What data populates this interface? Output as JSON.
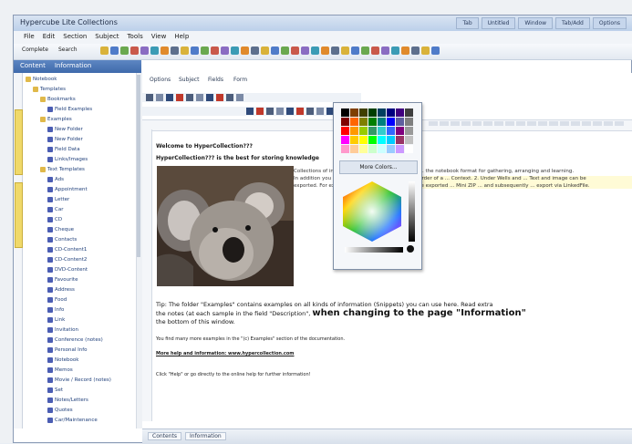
{
  "window": {
    "title": "Hypercube Lite Collections"
  },
  "title_tabs": [
    "Tab",
    "Untitled",
    "Window",
    "Tab/Add",
    "Options"
  ],
  "menu": [
    "File",
    "Edit",
    "Section",
    "Subject",
    "Tools",
    "View",
    "Help"
  ],
  "toolbar": {
    "label_a": "Complete",
    "label_b": "Search"
  },
  "left_pane": {
    "tabs": [
      "Content",
      "Information"
    ]
  },
  "tree": [
    {
      "label": "Notebook",
      "indent": 0,
      "folder": true
    },
    {
      "label": "Templates",
      "indent": 1,
      "folder": true
    },
    {
      "label": "Bookmarks",
      "indent": 2,
      "folder": true
    },
    {
      "label": "Field Examples",
      "indent": 3,
      "folder": false
    },
    {
      "label": "Examples",
      "indent": 2,
      "folder": true
    },
    {
      "label": "New Folder",
      "indent": 3,
      "folder": false
    },
    {
      "label": "New Folder",
      "indent": 3,
      "folder": false
    },
    {
      "label": "Field Data",
      "indent": 3,
      "folder": false
    },
    {
      "label": "Links/Images",
      "indent": 3,
      "folder": false
    },
    {
      "label": "Text Templates",
      "indent": 2,
      "folder": true
    },
    {
      "label": "Ads",
      "indent": 3,
      "folder": false
    },
    {
      "label": "Appointment",
      "indent": 3,
      "folder": false
    },
    {
      "label": "Letter",
      "indent": 3,
      "folder": false
    },
    {
      "label": "Car",
      "indent": 3,
      "folder": false
    },
    {
      "label": "CD",
      "indent": 3,
      "folder": false
    },
    {
      "label": "Cheque",
      "indent": 3,
      "folder": false
    },
    {
      "label": "Contacts",
      "indent": 3,
      "folder": false
    },
    {
      "label": "CD-Content1",
      "indent": 3,
      "folder": false
    },
    {
      "label": "CD-Content2",
      "indent": 3,
      "folder": false
    },
    {
      "label": "DVD-Content",
      "indent": 3,
      "folder": false
    },
    {
      "label": "Favourite",
      "indent": 3,
      "folder": false
    },
    {
      "label": "Address",
      "indent": 3,
      "folder": false
    },
    {
      "label": "Food",
      "indent": 3,
      "folder": false
    },
    {
      "label": "Info",
      "indent": 3,
      "folder": false
    },
    {
      "label": "Link",
      "indent": 3,
      "folder": false
    },
    {
      "label": "Invitation",
      "indent": 3,
      "folder": false
    },
    {
      "label": "Conference (notes)",
      "indent": 3,
      "folder": false
    },
    {
      "label": "Personal Info",
      "indent": 3,
      "folder": false
    },
    {
      "label": "Notebook",
      "indent": 3,
      "folder": false
    },
    {
      "label": "Memos",
      "indent": 3,
      "folder": false
    },
    {
      "label": "Movie / Record (notes)",
      "indent": 3,
      "folder": false
    },
    {
      "label": "Set",
      "indent": 3,
      "folder": false
    },
    {
      "label": "Notes/Letters",
      "indent": 3,
      "folder": false
    },
    {
      "label": "Quotes",
      "indent": 3,
      "folder": false
    },
    {
      "label": "Car/Maintenance",
      "indent": 3,
      "folder": false
    }
  ],
  "editor": {
    "tb1_items": [
      "Options",
      "Subject",
      "Fields",
      "Form"
    ],
    "line1": "Welcome to HyperCollection???",
    "line2": "HyperCollection??? is the best for storing knowledge",
    "right_lines": [
      "Collections of information (Snippets) can be used ... the notebook format for gathering, arranging and learning.",
      "In addition you can use ... Contacts. Example the order of a ... Context. 2. Under Wells and ... Text and image can be",
      "exported. For example in Notebook format it can be exported ... Mini ZIP ... and subsequently ... export via LinkedFile."
    ],
    "tip_a": "Tip: The folder \"Examples\" contains examples on all kinds of information (Snippets) you can use here. Read extra",
    "tip_b": "the notes (at each sample in the field \"Description\",",
    "tip_big": "when changing to the page \"Information\"",
    "tip_c": "the bottom of this window.",
    "small1": "You find many more examples in the \"(c) Examples\" section of the documentation.",
    "small2": "More help and information: www.hypercollection.com",
    "small3": "Click \"Help\" or go directly to the online help for further information!"
  },
  "picker": {
    "more_label": "More Colors..."
  },
  "status_tabs": [
    "Contents",
    "Information"
  ],
  "colors": {
    "accent": "#3f6aab",
    "highlight": "#fffbd6"
  }
}
